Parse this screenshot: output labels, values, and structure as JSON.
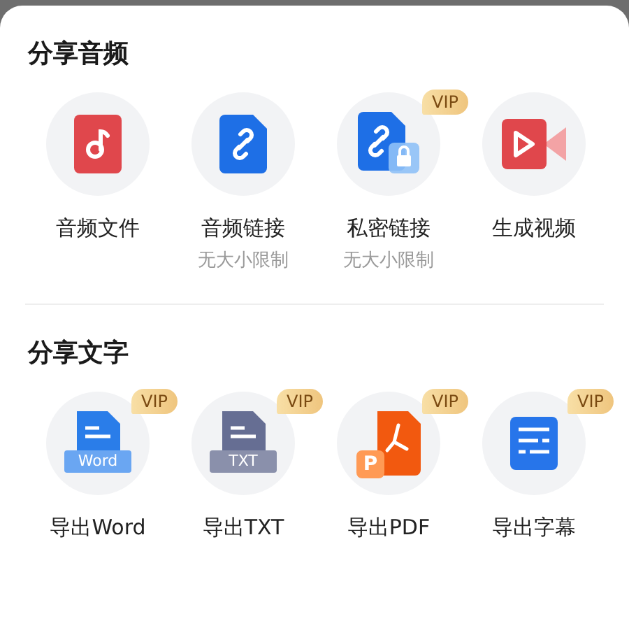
{
  "sections": [
    {
      "title": "分享音频",
      "items": [
        {
          "kind": "audio",
          "label": "音频文件"
        },
        {
          "kind": "link",
          "label": "音频链接",
          "note": "无大小限制"
        },
        {
          "kind": "private",
          "label": "私密链接",
          "note": "无大小限制",
          "badge": "VIP"
        },
        {
          "kind": "video",
          "label": "生成视频"
        }
      ]
    },
    {
      "title": "分享文字",
      "items": [
        {
          "kind": "word",
          "label": "导出Word",
          "badge": "VIP",
          "icon_text": "Word"
        },
        {
          "kind": "txt",
          "label": "导出TXT",
          "badge": "VIP",
          "icon_text": "TXT"
        },
        {
          "kind": "pdf",
          "label": "导出PDF",
          "badge": "VIP",
          "icon_text": "P"
        },
        {
          "kind": "subtitle",
          "label": "导出字幕",
          "badge": "VIP"
        }
      ]
    }
  ]
}
